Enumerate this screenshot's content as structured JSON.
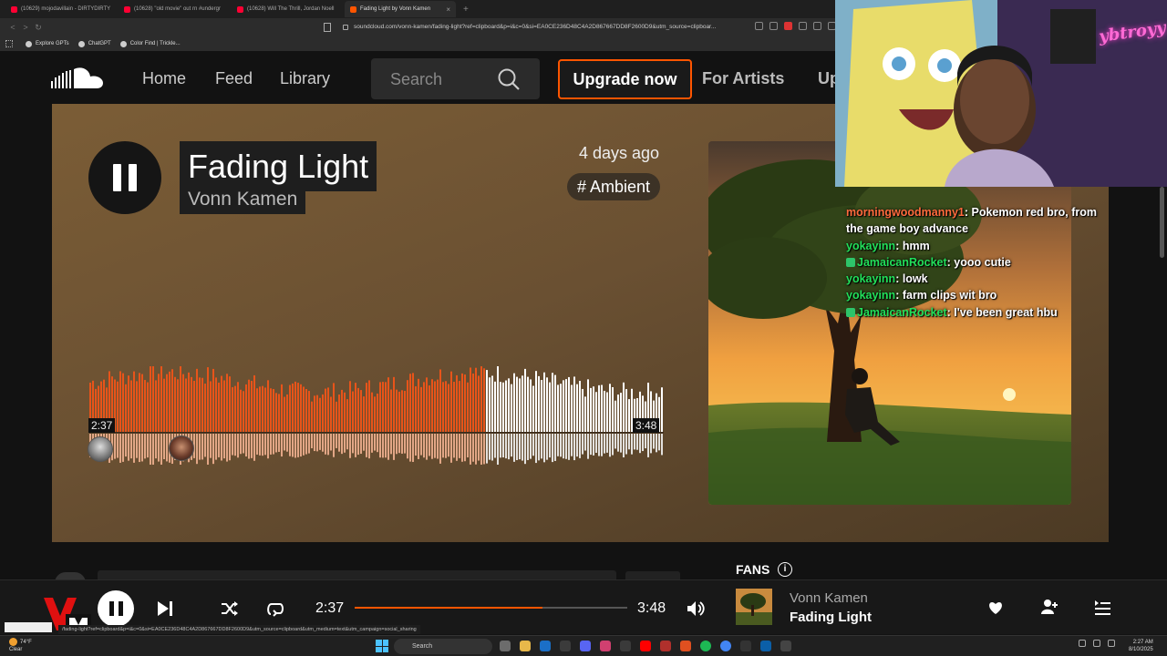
{
  "browser": {
    "tabs": [
      {
        "title": "(10629) mojodavillain - DIRTYDIRTY"
      },
      {
        "title": "(10628) \"old movie\" out rn #undergr"
      },
      {
        "title": "(10628) Will The Thrill, Jordan Noell"
      },
      {
        "title": "Fading Light by Vonn Kamen"
      }
    ],
    "url": "soundcloud.com/vonn-kamen/fading-light?ref=clipboard&p=i&c=0&si=EA0CE236D48C4A2D867667DD8F2600D9&utm_source=clipboar...",
    "bookmarks": [
      "Explore GPTs",
      "ChatGPT",
      "Color Find | Trickle..."
    ]
  },
  "header": {
    "nav": [
      "Home",
      "Feed",
      "Library"
    ],
    "search_placeholder": "Search",
    "upgrade_label": "Upgrade now",
    "for_artists_label": "For Artists",
    "cut_label": "Up"
  },
  "track": {
    "title": "Fading Light",
    "artist": "Vonn Kamen",
    "posted": "4 days ago",
    "tag": "# Ambient",
    "current_time": "2:37",
    "duration": "3:48",
    "progress_fraction": 0.69
  },
  "sidebar": {
    "fans_label": "FANS",
    "info_glyph": "i"
  },
  "player": {
    "current_time": "2:37",
    "duration": "3:48",
    "progress_fraction": 0.69,
    "artist": "Vonn Kamen",
    "title": "Fading Light"
  },
  "status_url": "/fading-light?ref=clipboard&p=i&c=0&si=EA0CE236D48C4A2D867667DD8F2600D9&utm_source=clipboard&utm_medium=text&utm_campaign=social_sharing",
  "overlay": {
    "streamer_name": "ybtroyy",
    "chat": [
      {
        "user": "morningwoodmanny1",
        "color": "#ff6a3d",
        "badge": false,
        "text": ": Pokemon red bro, from the game boy advance"
      },
      {
        "user": "yokayinn",
        "color": "#22e05a",
        "badge": false,
        "text": ": hmm"
      },
      {
        "user": "JamaicanRocket",
        "color": "#22e05a",
        "badge": true,
        "text": ": yooo cutie"
      },
      {
        "user": "yokayinn",
        "color": "#22e05a",
        "badge": false,
        "text": ": lowk"
      },
      {
        "user": "yokayinn",
        "color": "#22e05a",
        "badge": false,
        "text": ": farm clips wit bro"
      },
      {
        "user": "JamaicanRocket",
        "color": "#22e05a",
        "badge": true,
        "text": ": I've been great hbu"
      }
    ]
  },
  "taskbar": {
    "weather_temp": "74°F",
    "weather_desc": "Clear",
    "search_label": "Search",
    "time": "2:27 AM",
    "date": "8/10/2025"
  },
  "colors": {
    "accent": "#ff5500",
    "wave_played": "#e8541a",
    "wave_unplayed": "#ffffff"
  }
}
